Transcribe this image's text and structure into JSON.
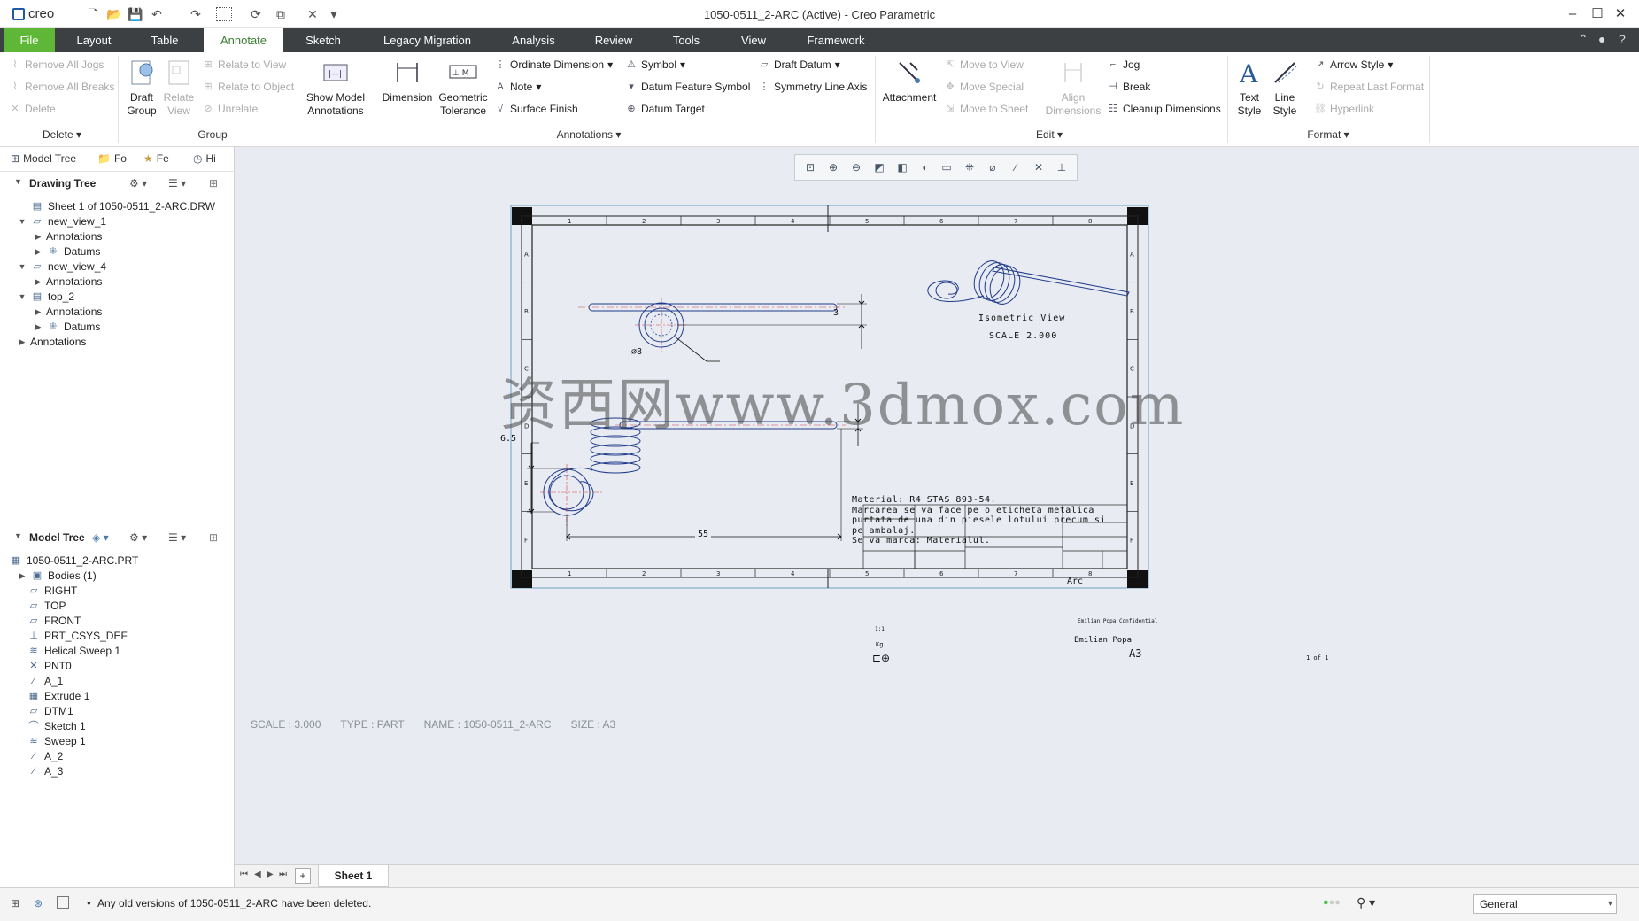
{
  "app": {
    "logo": "creo",
    "title": "1050-0511_2-ARC (Active) - Creo Parametric"
  },
  "tabs": [
    "File",
    "Layout",
    "Table",
    "Annotate",
    "Sketch",
    "Legacy Migration",
    "Analysis",
    "Review",
    "Tools",
    "View",
    "Framework"
  ],
  "ribbon": {
    "delete": {
      "remove_all_jogs": "Remove All Jogs",
      "remove_all_breaks": "Remove All Breaks",
      "delete": "Delete",
      "label": "Delete"
    },
    "group": {
      "draft_group": "Draft\nGroup",
      "relate_view": "Relate\nView",
      "relate_to_view": "Relate to View",
      "relate_to_object": "Relate to Object",
      "unrelate": "Unrelate",
      "label": "Group"
    },
    "annotations": {
      "show_model": "Show Model\nAnnotations",
      "dimension": "Dimension",
      "geometric": "Geometric\nTolerance",
      "ordinate": "Ordinate Dimension",
      "note": "Note",
      "surface_finish": "Surface Finish",
      "symbol": "Symbol",
      "datum_feature": "Datum Feature Symbol",
      "datum_target": "Datum Target",
      "draft_datum": "Draft Datum",
      "symmetry": "Symmetry Line Axis",
      "label": "Annotations"
    },
    "edit": {
      "attachment": "Attachment",
      "move_to_view": "Move to View",
      "move_special": "Move Special",
      "move_to_sheet": "Move to Sheet",
      "align": "Align\nDimensions",
      "jog": "Jog",
      "break": "Break",
      "cleanup": "Cleanup Dimensions",
      "label": "Edit"
    },
    "format": {
      "text_style": "Text\nStyle",
      "line_style": "Line\nStyle",
      "arrow_style": "Arrow Style",
      "repeat": "Repeat Last Format",
      "hyperlink": "Hyperlink",
      "label": "Format"
    }
  },
  "leftpane": {
    "tabs": [
      "Model Tree",
      "Fo",
      "Fe",
      "Hi"
    ],
    "drawing_tree_title": "Drawing Tree",
    "drawing_tree": [
      {
        "label": "Sheet 1 of 1050-0511_2-ARC.DRW",
        "level": 0,
        "toggle": ""
      },
      {
        "label": "new_view_1",
        "level": 0,
        "toggle": "▼"
      },
      {
        "label": "Annotations",
        "level": 1,
        "toggle": "▶"
      },
      {
        "label": "Datums",
        "level": 1,
        "toggle": "▶"
      },
      {
        "label": "new_view_4",
        "level": 0,
        "toggle": "▼"
      },
      {
        "label": "Annotations",
        "level": 1,
        "toggle": "▶"
      },
      {
        "label": "top_2",
        "level": 0,
        "toggle": "▼"
      },
      {
        "label": "Annotations",
        "level": 1,
        "toggle": "▶"
      },
      {
        "label": "Datums",
        "level": 1,
        "toggle": "▶"
      },
      {
        "label": "Annotations",
        "level": -1,
        "toggle": "▶"
      }
    ],
    "model_tree_title": "Model Tree",
    "model_tree": [
      "1050-0511_2-ARC.PRT",
      "Bodies (1)",
      "RIGHT",
      "TOP",
      "FRONT",
      "PRT_CSYS_DEF",
      "Helical Sweep 1",
      "PNT0",
      "A_1",
      "Extrude 1",
      "DTM1",
      "Sketch 1",
      "Sweep 1",
      "A_2",
      "A_3"
    ]
  },
  "drawing": {
    "zones_x": [
      "1",
      "2",
      "3",
      "4",
      "5",
      "6",
      "7",
      "8"
    ],
    "zones_y": [
      "A",
      "B",
      "C",
      "D",
      "E",
      "F"
    ],
    "dim_diameter": "⌀8",
    "dim_3": "3",
    "dim_65": "6.5",
    "dim_55": "55",
    "iso_label": "Isometric View",
    "iso_scale": "SCALE 2.000",
    "notes": [
      "Material: R4 STAS 893-54.",
      "Marcarea se va face pe o eticheta metalica",
      "purtata de una din piesele lotului precum si",
      "pe ambalaj.",
      "Se va marca: Materialul."
    ],
    "tb_arc": "Arc",
    "tb_a3": "A3",
    "tb_scale": "1:1",
    "tb_designer": "Emilian Popa",
    "tb_conf": "Emilian Popa Confidential",
    "tb_sheet": "1 of 1",
    "tb_kg": "Kg",
    "watermark": "资西网www.3dmox.com"
  },
  "infobar": {
    "scale": "SCALE : 3.000",
    "type": "TYPE : PART",
    "name": "NAME : 1050-0511_2-ARC",
    "size": "SIZE : A3"
  },
  "sheet_tab": "Sheet 1",
  "status": {
    "message": "Any old versions of 1050-0511_2-ARC have been deleted.",
    "filter": "General"
  }
}
